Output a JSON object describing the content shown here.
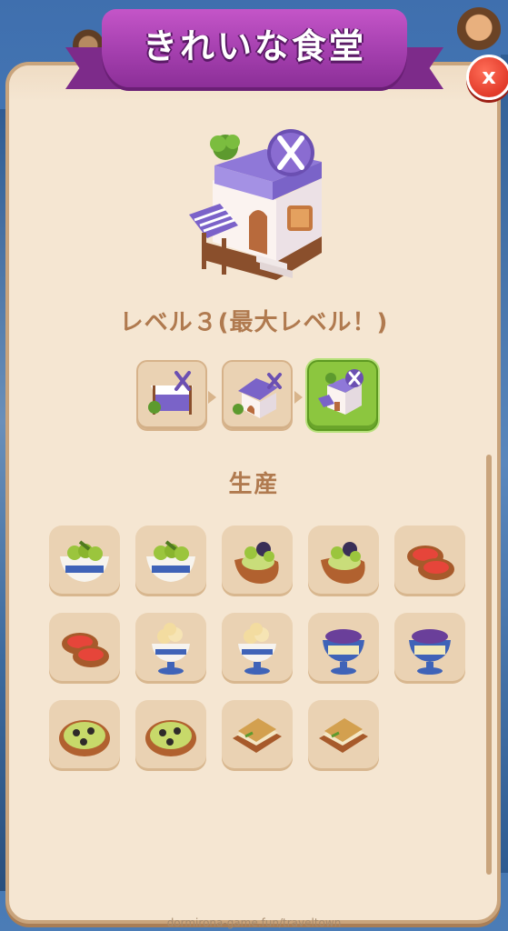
{
  "dialog": {
    "title": "きれいな食堂",
    "close_label": "x"
  },
  "level": {
    "text": "レベル３(最大レベル！)",
    "current": 3,
    "max": 3,
    "steps": [
      {
        "name": "level-1-market-stall"
      },
      {
        "name": "level-2-small-house"
      },
      {
        "name": "level-3-restaurant"
      }
    ]
  },
  "production": {
    "title": "生産",
    "items": [
      {
        "name": "olive-bowl"
      },
      {
        "name": "olive-bowl"
      },
      {
        "name": "olive-bread-dish"
      },
      {
        "name": "olive-bread-dish"
      },
      {
        "name": "tomato-bread-plate"
      },
      {
        "name": "tomato-bread-plate"
      },
      {
        "name": "cream-dessert-cup"
      },
      {
        "name": "cream-dessert-cup"
      },
      {
        "name": "grape-dessert-cup"
      },
      {
        "name": "grape-dessert-cup"
      },
      {
        "name": "olive-pizza-toast"
      },
      {
        "name": "olive-pizza-toast"
      },
      {
        "name": "cheese-sandwich"
      },
      {
        "name": "cheese-sandwich"
      }
    ]
  },
  "watermark": "dormirona-game.fun/traveltown",
  "colors": {
    "panel": "#f5e6d2",
    "ribbon": "#a43fae",
    "active_step": "#8cc63f",
    "text_brown": "#b07a4f",
    "close": "#e23b2a"
  }
}
